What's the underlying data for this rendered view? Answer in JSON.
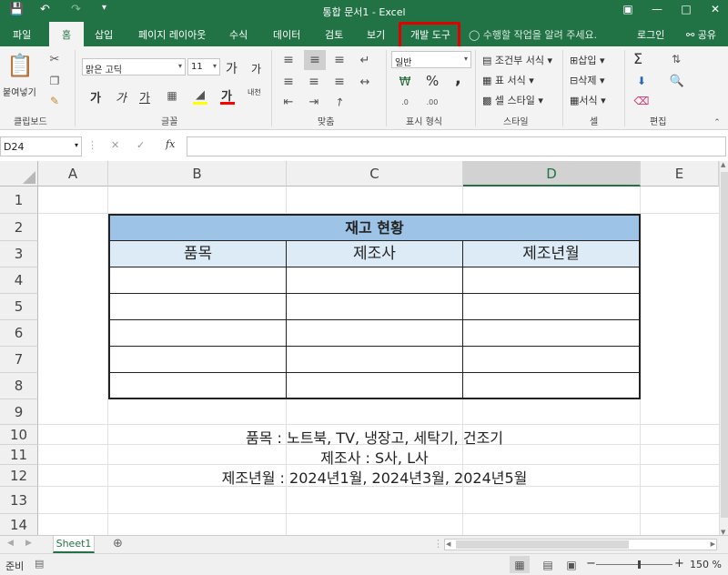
{
  "window": {
    "title": "통합 문서1 - Excel",
    "qa_save_icon": "save-icon",
    "qa_undo_icon": "undo-icon",
    "qa_redo_icon": "redo-icon",
    "qa_customize_icon": "customize-qa-icon"
  },
  "ribbon_tabs": [
    {
      "label": "파일"
    },
    {
      "label": "홈",
      "active": true
    },
    {
      "label": "삽입"
    },
    {
      "label": "페이지 레이아웃"
    },
    {
      "label": "수식"
    },
    {
      "label": "데이터"
    },
    {
      "label": "검토"
    },
    {
      "label": "보기"
    },
    {
      "label": "개발 도구",
      "highlighted": true
    }
  ],
  "tell_me": "수행할 작업을 알려 주세요.",
  "signin": "로그인",
  "share": "공유",
  "ribbon": {
    "clipboard": {
      "paste": "붙여넣기",
      "label": "클립보드"
    },
    "font": {
      "name": "맑은 고딕",
      "size": "11",
      "bold": "가",
      "italic": "가",
      "underline": "가",
      "grow": "가",
      "shrink": "가",
      "color_glyph": "가",
      "phonetic": "내천",
      "label": "글꼴"
    },
    "align": {
      "label": "맞춤"
    },
    "number": {
      "format": "일반",
      "percent": "%",
      "comma": ",",
      "label": "표시 형식"
    },
    "styles": {
      "conditional": "조건부 서식",
      "table": "표 서식",
      "cell": "셀 스타일",
      "label": "스타일"
    },
    "cells": {
      "insert": "삽입",
      "delete": "삭제",
      "format": "서식",
      "label": "셀"
    },
    "editing": {
      "sum": "Σ",
      "label": "편집"
    }
  },
  "formula_bar": {
    "cell_ref": "D24",
    "cancel": "✕",
    "enter": "✓",
    "fx": "fx",
    "value": ""
  },
  "columns": [
    "A",
    "B",
    "C",
    "D",
    "E"
  ],
  "rows": [
    "1",
    "2",
    "3",
    "4",
    "5",
    "6",
    "7",
    "8",
    "9",
    "10",
    "11",
    "12",
    "13",
    "14"
  ],
  "inventory_table": {
    "title": "재고 현황",
    "headers": [
      "품목",
      "제조사",
      "제조년월"
    ]
  },
  "notes": {
    "items": "품목 : 노트북, TV, 냉장고, 세탁기, 건조기",
    "makers": "제조사 : S사, L사",
    "dates": "제조년월 : 2024년1월, 2024년3월, 2024년5월"
  },
  "sheet_tabs": [
    {
      "label": "Sheet1",
      "active": true
    }
  ],
  "status": {
    "mode": "준비",
    "zoom": "150 %",
    "zoom_minus": "−",
    "zoom_plus": "+"
  },
  "colors": {
    "accent": "#217346",
    "highlight": "#e00000",
    "title_fill": "#9dc3e6",
    "header_fill": "#ddebf7"
  }
}
